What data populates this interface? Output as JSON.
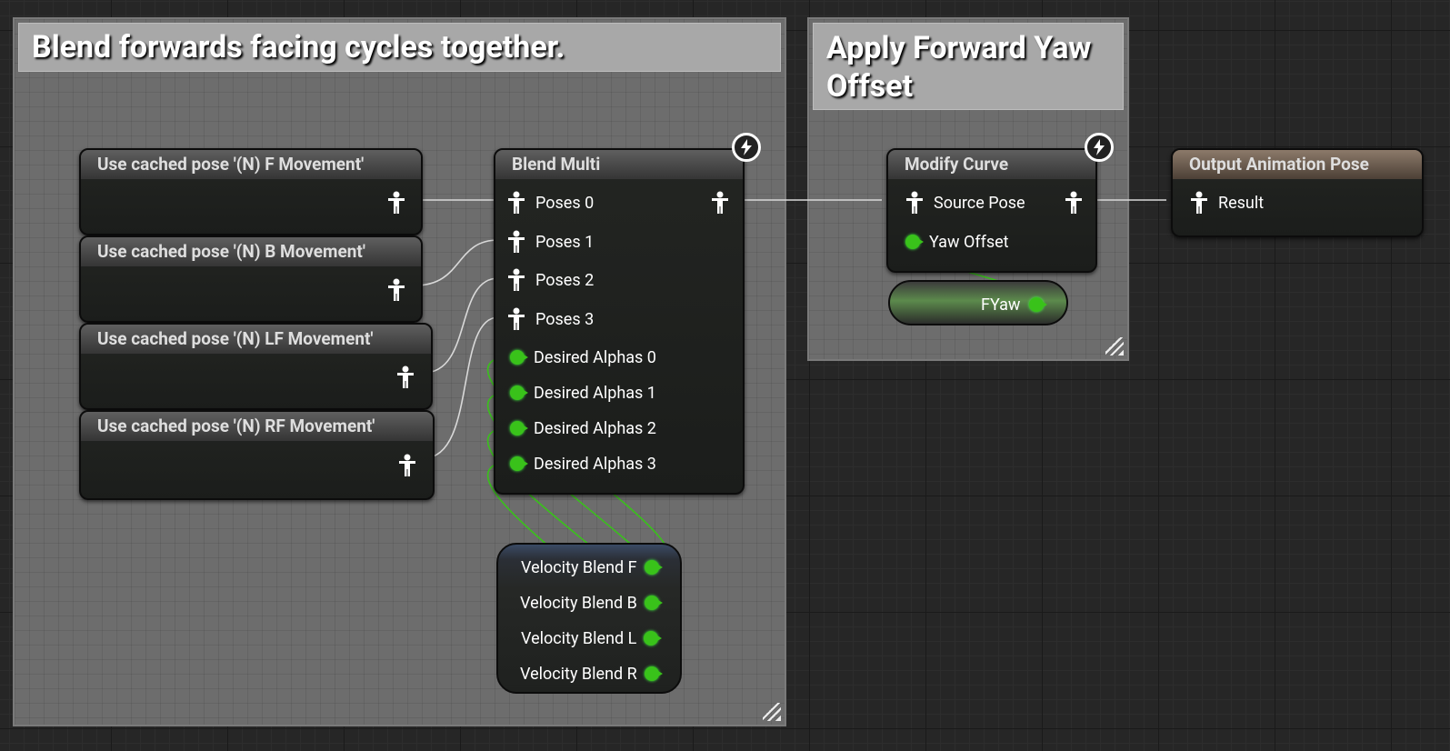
{
  "comments": {
    "blend": {
      "title": "Blend forwards facing cycles together."
    },
    "yaw": {
      "title": "Apply Forward Yaw Offset"
    }
  },
  "cached_poses": [
    {
      "title": "Use cached pose '(N) F Movement'"
    },
    {
      "title": "Use cached pose '(N) B Movement'"
    },
    {
      "title": "Use cached pose '(N) LF Movement'"
    },
    {
      "title": "Use cached pose '(N) RF Movement'"
    }
  ],
  "blend_multi": {
    "title": "Blend Multi",
    "poses": [
      "Poses 0",
      "Poses 1",
      "Poses 2",
      "Poses 3"
    ],
    "alphas": [
      "Desired Alphas 0",
      "Desired Alphas 1",
      "Desired Alphas 2",
      "Desired Alphas 3"
    ]
  },
  "velocity_node": {
    "outputs": [
      "Velocity Blend F",
      "Velocity Blend B",
      "Velocity Blend L",
      "Velocity Blend R"
    ]
  },
  "modify_curve": {
    "title": "Modify Curve",
    "source_pose": "Source Pose",
    "yaw_offset": "Yaw Offset"
  },
  "fyaw": {
    "label": "FYaw"
  },
  "output_pose": {
    "title": "Output Animation Pose",
    "result": "Result"
  },
  "colors": {
    "float_pin": "#39c21a",
    "exec_wire": "#d9d9d9",
    "comment_bg": "#6d6d6d"
  }
}
